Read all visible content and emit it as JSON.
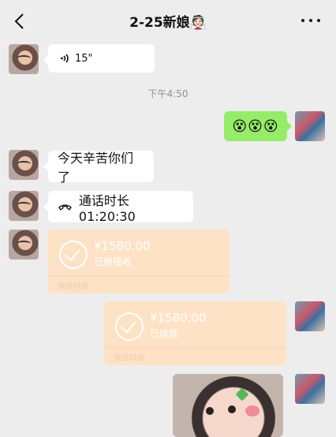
{
  "header": {
    "title": "2-25新娘",
    "title_emoji": "👰🏻"
  },
  "messages": {
    "voice": {
      "duration": "15\""
    },
    "time_divider": "下午4:50",
    "emoji_msg": "😵😵😵",
    "text_msg": "今天辛苦你们了",
    "call": {
      "label": "通话时长 01:20:30"
    },
    "transfer_in": {
      "amount": "¥1580.00",
      "status": "已被接收",
      "footer": "微信转账"
    },
    "transfer_out": {
      "amount": "¥1580.00",
      "status": "已收款",
      "footer": "微信转账"
    }
  }
}
